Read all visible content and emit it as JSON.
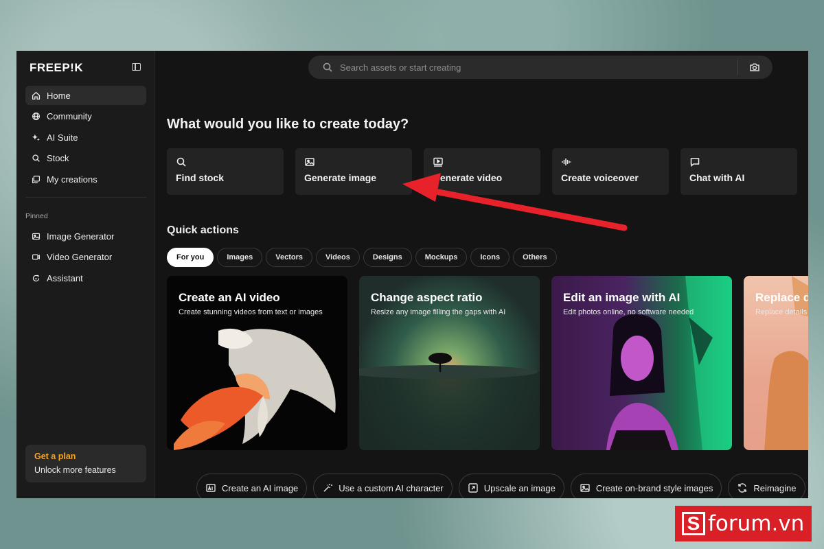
{
  "brand": {
    "logo": "FREEP!K"
  },
  "sidebar": {
    "nav": [
      {
        "label": "Home",
        "icon": "home-icon"
      },
      {
        "label": "Community",
        "icon": "globe-icon"
      },
      {
        "label": "AI Suite",
        "icon": "sparkle-icon"
      },
      {
        "label": "Stock",
        "icon": "search-icon"
      },
      {
        "label": "My creations",
        "icon": "gallery-icon"
      }
    ],
    "pinned_label": "Pinned",
    "pinned": [
      {
        "label": "Image Generator",
        "icon": "image-icon"
      },
      {
        "label": "Video Generator",
        "icon": "video-icon"
      },
      {
        "label": "Assistant",
        "icon": "assistant-icon"
      }
    ],
    "plan": {
      "title": "Get a plan",
      "subtitle": "Unlock more features"
    }
  },
  "search": {
    "placeholder": "Search assets or start creating"
  },
  "main": {
    "heading": "What would you like to create today?",
    "create_cards": [
      {
        "label": "Find stock",
        "icon": "search-icon"
      },
      {
        "label": "Generate image",
        "icon": "image-icon"
      },
      {
        "label": "Generate video",
        "icon": "play-icon"
      },
      {
        "label": "Create voiceover",
        "icon": "waveform-icon"
      },
      {
        "label": "Chat with AI",
        "icon": "chat-icon"
      }
    ],
    "quick_title": "Quick actions",
    "filters": [
      "For you",
      "Images",
      "Vectors",
      "Videos",
      "Designs",
      "Mockups",
      "Icons",
      "Others"
    ],
    "active_filter": "For you",
    "quick_cards": [
      {
        "title": "Create an AI video",
        "subtitle": "Create stunning videos from text or images"
      },
      {
        "title": "Change aspect ratio",
        "subtitle": "Resize any image filling the gaps with AI"
      },
      {
        "title": "Edit an image with AI",
        "subtitle": "Edit photos online, no software needed"
      },
      {
        "title": "Replace d",
        "subtitle": "Replace details"
      }
    ],
    "bottom_actions": [
      {
        "label": "Create an AI image",
        "icon": "ai-image-icon"
      },
      {
        "label": "Use a custom AI character",
        "icon": "magic-wand-icon"
      },
      {
        "label": "Upscale an image",
        "icon": "upscale-icon"
      },
      {
        "label": "Create on-brand style images",
        "icon": "image-icon"
      },
      {
        "label": "Reimagine",
        "icon": "refresh-icon"
      }
    ]
  },
  "watermark": {
    "s": "S",
    "text": "forum.vn"
  },
  "colors": {
    "plan_accent": "#f5a623",
    "arrow": "#e8222a",
    "watermark": "#d92026"
  }
}
